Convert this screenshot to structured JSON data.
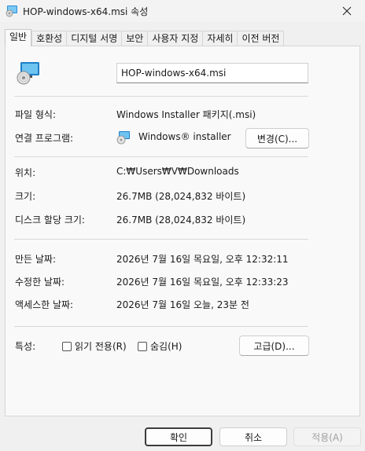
{
  "window": {
    "title": "HOP-windows-x64.msi 속성",
    "icon": "msi-installer-icon"
  },
  "tabs": [
    {
      "label": "일반",
      "active": true
    },
    {
      "label": "호환성",
      "active": false
    },
    {
      "label": "디지털 서명",
      "active": false
    },
    {
      "label": "보안",
      "active": false
    },
    {
      "label": "사용자 지정",
      "active": false
    },
    {
      "label": "자세히",
      "active": false
    },
    {
      "label": "이전 버전",
      "active": false
    }
  ],
  "general": {
    "file_name": "HOP-windows-x64.msi",
    "file_type_label": "파일 형식:",
    "file_type_value": "Windows Installer 패키지(.msi)",
    "opens_with_label": "연결 프로그램:",
    "opens_with_value": "Windows® installer",
    "change_button": "변경(C)...",
    "location_label": "위치:",
    "location_value": "C:₩Users₩V₩Downloads",
    "size_label": "크기:",
    "size_value": "26.7MB (28,024,832 바이트)",
    "size_on_disk_label": "디스크 할당 크기:",
    "size_on_disk_value": "26.7MB (28,024,832 바이트)",
    "created_label": "만든 날짜:",
    "created_value": "2026년 7월 16일 목요일, 오후 12:32:11",
    "modified_label": "수정한 날짜:",
    "modified_value": "2026년 7월 16일 목요일, 오후 12:33:23",
    "accessed_label": "액세스한 날짜:",
    "accessed_value": "2026년 7월 16일 오늘, 23분 전",
    "attributes_label": "특성:",
    "readonly_label": "읽기 전용(R)",
    "readonly_checked": false,
    "hidden_label": "숨김(H)",
    "hidden_checked": false,
    "advanced_button": "고급(D)..."
  },
  "footer": {
    "ok_button": "확인",
    "cancel_button": "취소",
    "apply_button": "적용(A)",
    "apply_enabled": false
  }
}
